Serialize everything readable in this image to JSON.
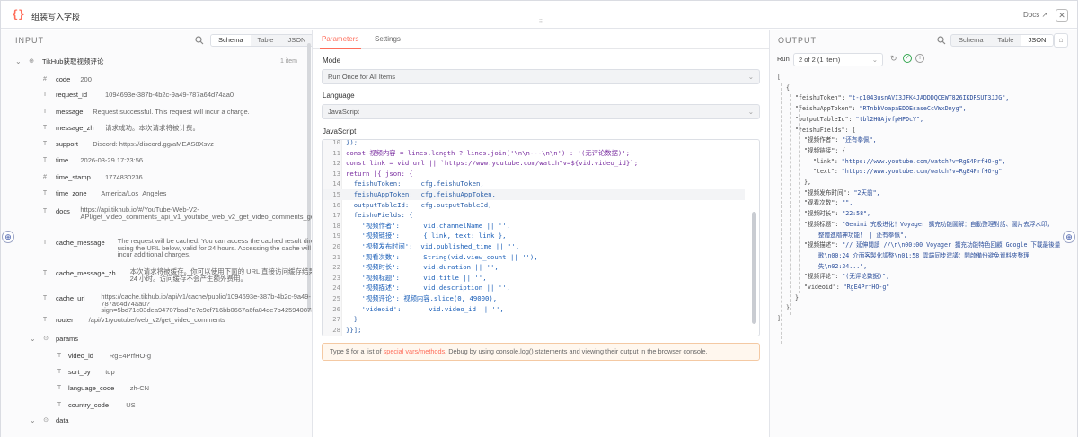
{
  "header": {
    "title": "组装写入字段",
    "docs": "Docs ↗",
    "logo": "{}"
  },
  "input": {
    "title": "INPUT",
    "tabs": [
      "Schema",
      "Table",
      "JSON"
    ],
    "node": {
      "name": "TikHub获取视频评论",
      "count": "1 item"
    },
    "fields": [
      {
        "type": "#",
        "key": "code",
        "value": "200"
      },
      {
        "type": "T",
        "key": "request_id",
        "value": "1094693e-387b-4b2c-9a49-787a64d74aa0"
      },
      {
        "type": "T",
        "key": "message",
        "value": "Request successful. This request will incur a charge."
      },
      {
        "type": "T",
        "key": "message_zh",
        "value": "请求成功。本次请求将被计费。"
      },
      {
        "type": "T",
        "key": "support",
        "value": "Discord: https://discord.gg/aMEAS8Xsvz"
      },
      {
        "type": "T",
        "key": "time",
        "value": "2026-03-29 17:23:56"
      },
      {
        "type": "#",
        "key": "time_stamp",
        "value": "1774830236"
      },
      {
        "type": "T",
        "key": "time_zone",
        "value": "America/Los_Angeles"
      },
      {
        "type": "T",
        "key": "docs",
        "value": "https://api.tikhub.io/#/YouTube-Web-V2-API/get_video_comments_api_v1_youtube_web_v2_get_video_comments_get"
      },
      {
        "type": "T",
        "key": "cache_message",
        "value": "The request will be cached. You can access the cached result directly using the URL below, valid for 24 hours. Accessing the cache will not incur additional charges."
      },
      {
        "type": "T",
        "key": "cache_message_zh",
        "value": "本次请求将被缓存。你可以使用下面的 URL 直接访问缓存结果，有效期为 24 小时。访问缓存不会产生额外费用。"
      },
      {
        "type": "T",
        "key": "cache_url",
        "value": "https://cache.tikhub.io/api/v1/cache/public/1094693e-387b-4b2c-9a49-787a64d74aa0?sign=5bd71c03dea94707bad7e7c9cf716bb0667a6fa84de7b425940873f1f75e0be0"
      },
      {
        "type": "T",
        "key": "router",
        "value": "/api/v1/youtube/web_v2/get_video_comments"
      }
    ],
    "params": {
      "key": "params",
      "children": [
        {
          "type": "T",
          "key": "video_id",
          "value": "RgE4PrfHO-g"
        },
        {
          "type": "T",
          "key": "sort_by",
          "value": "top"
        },
        {
          "type": "T",
          "key": "language_code",
          "value": "zh-CN"
        },
        {
          "type": "T",
          "key": "country_code",
          "value": "US"
        }
      ]
    },
    "data": {
      "key": "data"
    }
  },
  "middle": {
    "tabs": [
      "Parameters",
      "Settings"
    ],
    "mode_label": "Mode",
    "mode_value": "Run Once for All Items",
    "lang_label": "Language",
    "lang_value": "JavaScript",
    "js_label": "JavaScript",
    "code_lines": [
      {
        "n": "10",
        "t": "});"
      },
      {
        "n": "11",
        "t": "const 视频内容 = lines.length ? lines.join('\\n\\n---\\n\\n') : '(无评论数据)';"
      },
      {
        "n": "12",
        "t": "const link = vid.url || `https://www.youtube.com/watch?v=${vid.video_id}`;"
      },
      {
        "n": "13",
        "t": "return [{ json: {"
      },
      {
        "n": "14",
        "t": "  feishuToken:     cfg.feishuToken,"
      },
      {
        "n": "15",
        "t": "  feishuAppToken:  cfg.feishuAppToken,"
      },
      {
        "n": "16",
        "t": "  outputTableId:   cfg.outputTableId,"
      },
      {
        "n": "17",
        "t": "  feishuFields: {"
      },
      {
        "n": "18",
        "t": "    '视频作者':      vid.channelName || '',"
      },
      {
        "n": "19",
        "t": "    '视频链接':      { link, text: link },"
      },
      {
        "n": "20",
        "t": "    '视频发布时间':  vid.published_time || '',"
      },
      {
        "n": "21",
        "t": "    '观看次数':      String(vid.view_count || ''),"
      },
      {
        "n": "22",
        "t": "    '视频时长':      vid.duration || '',"
      },
      {
        "n": "23",
        "t": "    '视频标题':      vid.title || '',"
      },
      {
        "n": "24",
        "t": "    '视频描述':      vid.description || '',"
      },
      {
        "n": "25",
        "t": "    '视频评论': 视频内容.slice(0, 49000),"
      },
      {
        "n": "26",
        "t": "    'videoid':       vid.video_id || '',"
      },
      {
        "n": "27",
        "t": "  }"
      },
      {
        "n": "28",
        "t": "}}];"
      }
    ],
    "hint_pre": "Type $ for a list of ",
    "hint_link": "special vars/methods",
    "hint_post": ". Debug by using console.log() statements and viewing their output in the browser console."
  },
  "output": {
    "title": "OUTPUT",
    "tabs": [
      "Schema",
      "Table",
      "JSON"
    ],
    "run_label": "Run",
    "run_value": "2 of 2 (1 item)",
    "json_lines": [
      {
        "i": 0,
        "t": "["
      },
      {
        "i": 1,
        "t": "{"
      },
      {
        "i": 2,
        "k": "\"feishuToken\": ",
        "v": "\"t-g1043usnAVI3JFK4JADDDQCEWT826IKDRSUT3JJG\","
      },
      {
        "i": 2,
        "k": "\"feishuAppToken\": ",
        "v": "\"RTnbbVoapaEDOEsaseCcVWxDnyg\","
      },
      {
        "i": 2,
        "k": "\"outputTableId\": ",
        "v": "\"tbl2HGAjvfpHPDcY\","
      },
      {
        "i": 2,
        "k": "\"feishuFields\": {",
        "v": ""
      },
      {
        "i": 3,
        "k": "\"视频作者\": ",
        "v": "\"还有拳佩\","
      },
      {
        "i": 3,
        "k": "\"视频链接\": {",
        "v": ""
      },
      {
        "i": 4,
        "k": "\"link\": ",
        "v": "\"https://www.youtube.com/watch?v=RgE4PrfHO-g\","
      },
      {
        "i": 4,
        "k": "\"text\": ",
        "v": "\"https://www.youtube.com/watch?v=RgE4PrfHO-g\""
      },
      {
        "i": 3,
        "k": "},",
        "v": ""
      },
      {
        "i": 3,
        "k": "\"视频发布时间\": ",
        "v": "\"2天前\","
      },
      {
        "i": 3,
        "k": "\"观看次数\": ",
        "v": "\"\","
      },
      {
        "i": 3,
        "k": "\"视频时长\": ",
        "v": "\"22:58\","
      },
      {
        "i": 3,
        "k": "\"视频标题\": ",
        "v": "\"Gemini 究极进化！Voyager 擴充功能圖解：自動整理對話、圖片去浮水印，"
      },
      {
        "i": 3,
        "k": "",
        "v": "    整體進階神功能！ | 还有拳佩\","
      },
      {
        "i": 3,
        "k": "\"视频描述\": ",
        "v": "\"// 延伸閱讀 //\\n\\n00:00 Voyager 擴充功能特色回顧 Google 下載最後量"
      },
      {
        "i": 3,
        "k": "",
        "v": "    歌\\n00:24 介面客製化調整\\n01:58 雲端同步建議：開啟備份避免資料夾整理"
      },
      {
        "i": 3,
        "k": "",
        "v": "    失\\n02:34...\","
      },
      {
        "i": 3,
        "k": "\"视频评论\": ",
        "v": "\"(无评论数据)\","
      },
      {
        "i": 3,
        "k": "\"videoid\": ",
        "v": "\"RgE4PrfHO-g\""
      },
      {
        "i": 2,
        "k": "}",
        "v": ""
      },
      {
        "i": 1,
        "t": "}"
      },
      {
        "i": 0,
        "t": "]"
      }
    ]
  }
}
